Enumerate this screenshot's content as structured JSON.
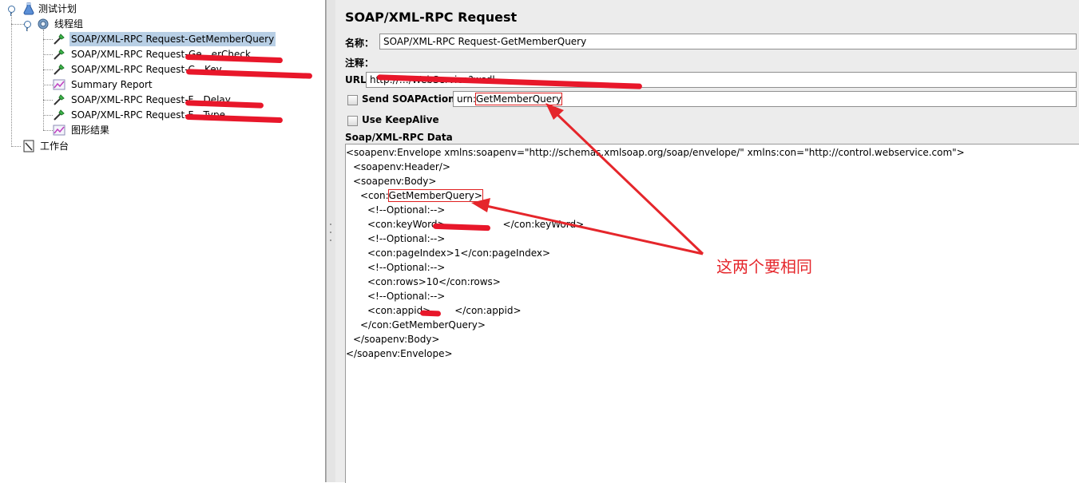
{
  "tree": {
    "test_plan": "测试计划",
    "thread_group": "线程组",
    "items": [
      {
        "label": "SOAP/XML-RPC Request-GetMemberQuery",
        "selected": true,
        "icon": "sampler-icon"
      },
      {
        "label": "SOAP/XML-RPC Request-Ge…erCheck",
        "icon": "sampler-icon"
      },
      {
        "label": "SOAP/XML-RPC Request-C…Key",
        "icon": "sampler-icon"
      },
      {
        "label": "Summary Report",
        "icon": "listener-graph-icon"
      },
      {
        "label": "SOAP/XML-RPC Request-F…Delay",
        "icon": "sampler-icon"
      },
      {
        "label": "SOAP/XML-RPC Request-F…Type",
        "icon": "sampler-icon"
      },
      {
        "label": "图形结果",
        "icon": "listener-graph-icon"
      }
    ],
    "workbench": "工作台"
  },
  "panel": {
    "title": "SOAP/XML-RPC Request",
    "name_label": "名称：",
    "name_value": "SOAP/XML-RPC Request-GetMemberQuery",
    "comment_label": "注释：",
    "comment_value": "",
    "url_label": "URL",
    "url_value": "http://…/WebService?wsdl",
    "soap_action_label": "Send SOAPAction:",
    "soap_action_checked": false,
    "soap_action_prefix": "urn:",
    "soap_action_value": "GetMemberQuery",
    "keepalive_label": "Use KeepAlive",
    "keepalive_checked": false,
    "data_label": "Soap/XML-RPC Data"
  },
  "xml": {
    "l1": "<soapenv:Envelope xmlns:soapenv=\"http://schemas.xmlsoap.org/soap/envelope/\" xmlns:con=\"http://control.webservice.com\">",
    "l2": "<soapenv:Header/>",
    "l3": "<soapenv:Body>",
    "l4a": "<con:",
    "l4b": "GetMemberQuery>",
    "l5": "<!--Optional:-->",
    "l6a": "<con:keyWord>",
    "l6b": "</con:keyWord>",
    "l7": "<!--Optional:-->",
    "l8": "<con:pageIndex>1</con:pageIndex>",
    "l9": "<!--Optional:-->",
    "l10": "<con:rows>10</con:rows>",
    "l11": "<!--Optional:-->",
    "l12a": "<con:appid>",
    "l12b": "</con:appid>",
    "l13": "</con:GetMemberQuery>",
    "l14": "</soapenv:Body>",
    "l15": "</soapenv:Envelope>"
  },
  "annotation": "这两个要相同",
  "colors": {
    "selection": "#b8cfe5",
    "annotation_red": "#e5262b",
    "panel_bg": "#ececec"
  }
}
